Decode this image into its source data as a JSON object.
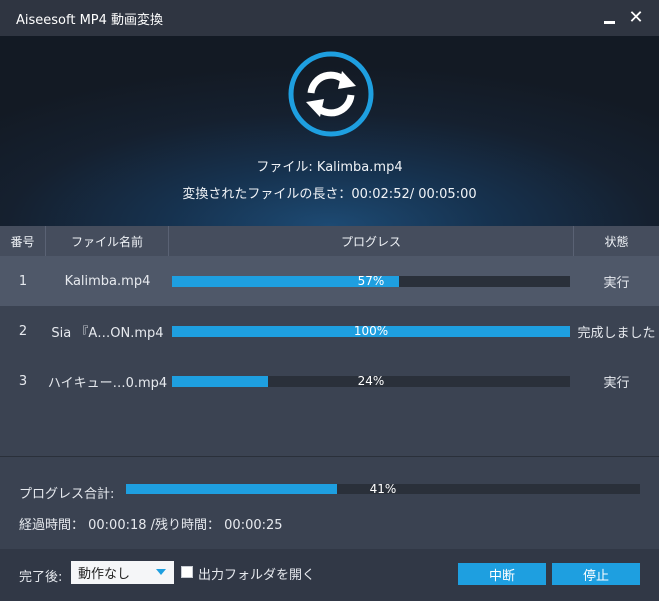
{
  "window": {
    "title": "Aiseesoft MP4 動画変換",
    "minimize_icon": "minimize-icon",
    "close_icon": "close-icon",
    "close_glyph": "✕"
  },
  "hero": {
    "icon": "convert-refresh-icon",
    "accent_color": "#1e9fe0",
    "file_line": "ファイル: Kalimba.mp4",
    "length_line": "変換されたファイルの長さ：00:02:52/ 00:05:00"
  },
  "table": {
    "headers": [
      "番号",
      "ファイル名前",
      "プログレス",
      "状態"
    ],
    "rows": [
      {
        "no": "1",
        "name": "Kalimba.mp4",
        "progress": 57,
        "progress_label": "57%",
        "state": "実行",
        "selected": true
      },
      {
        "no": "2",
        "name": "Sia 『A…ON.mp4",
        "progress": 100,
        "progress_label": "100%",
        "state": "完成しました",
        "selected": false
      },
      {
        "no": "3",
        "name": "ハイキュー…0.mp4",
        "progress": 24,
        "progress_label": "24%",
        "state": "実行",
        "selected": false
      }
    ]
  },
  "summary": {
    "label": "プログレス合計:",
    "progress": 41,
    "progress_label": "41%",
    "elapsed": "経過時間： 00:00:18 /残り時間： 00:00:25"
  },
  "footer": {
    "after_label": "完了後:",
    "after_value": "動作なし",
    "open_folder_label": "出力フォルダを開く",
    "open_folder_checked": false,
    "pause_label": "中断",
    "stop_label": "停止"
  }
}
